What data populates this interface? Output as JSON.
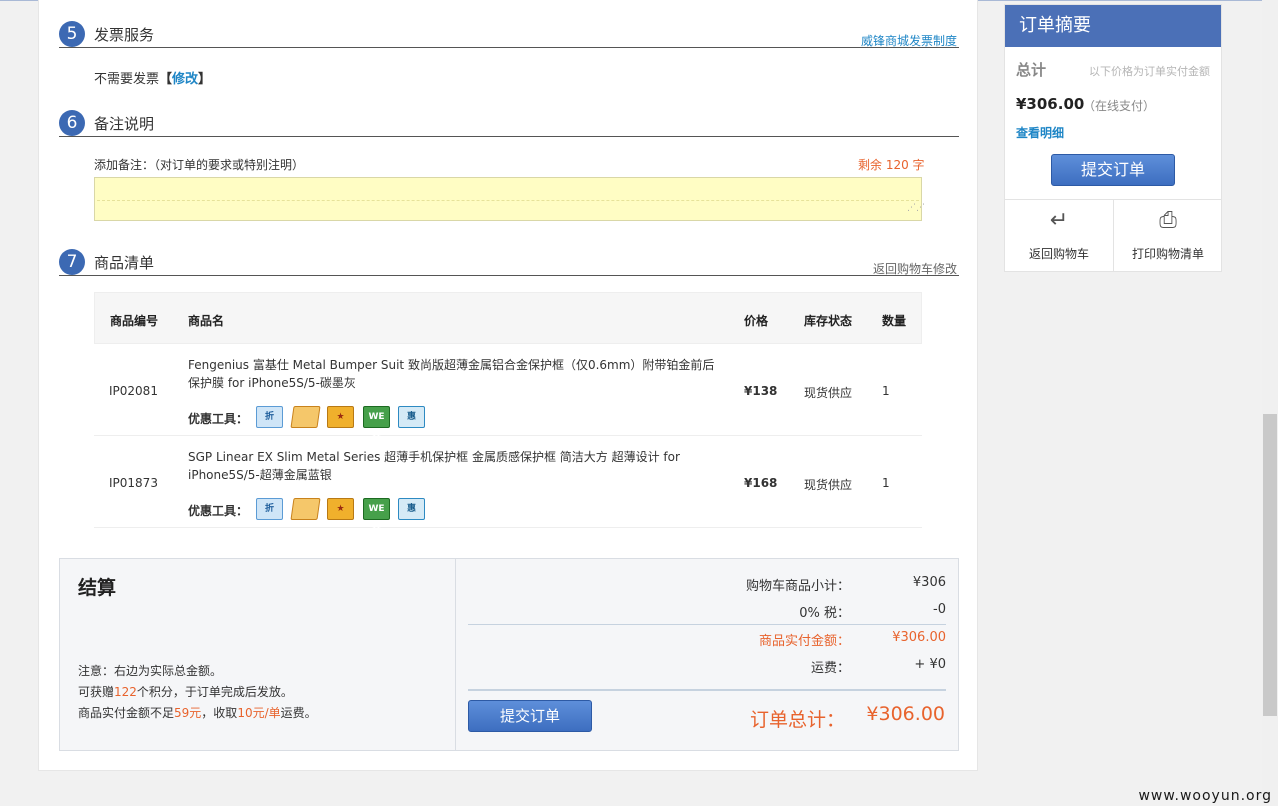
{
  "sections": {
    "invoice": {
      "num": "5",
      "title": "发票服务",
      "link": "威锋商城发票制度",
      "text": "不需要发票",
      "bracket_open": "【",
      "modify": "修改",
      "bracket_close": "】"
    },
    "remark": {
      "num": "6",
      "title": "备注说明",
      "label": "添加备注：（对订单的要求或特别注明）",
      "remaining": "剩余 120 字",
      "placeholder": ""
    },
    "goods": {
      "num": "7",
      "title": "商品清单",
      "link": "返回购物车修改"
    }
  },
  "table": {
    "headers": {
      "code": "商品编号",
      "name": "商品名",
      "price": "价格",
      "stock": "库存状态",
      "qty": "数量"
    },
    "rows": [
      {
        "code": "IP02081",
        "name": "Fengenius 富基仕 Metal Bumper Suit 致尚版超薄金属铝合金保护框（仅0.6mm）附带铂金前后保护膜 for iPhone5S/5-碳墨灰",
        "tools_label": "优惠工具：",
        "price": "¥138",
        "stock": "现货供应",
        "qty": "1"
      },
      {
        "code": "IP01873",
        "name": "SGP Linear EX Slim Metal Series 超薄手机保护框 金属质感保护框 简洁大方 超薄设计 for iPhone5S/5-超薄金属蓝银",
        "tools_label": "优惠工具：",
        "price": "¥168",
        "stock": "现货供应",
        "qty": "1"
      }
    ],
    "tool_icons": [
      {
        "icon": "member-discount-icon",
        "glyph": "折"
      },
      {
        "icon": "coupon-ticket-icon",
        "glyph": ""
      },
      {
        "icon": "star-voucher-icon",
        "glyph": "★"
      },
      {
        "icon": "we-coin-icon",
        "glyph": "WE券"
      },
      {
        "icon": "benefit-icon",
        "glyph": "惠"
      }
    ]
  },
  "settlement": {
    "title": "结算",
    "notes": {
      "line1": "注意：右边为实际总金额。",
      "line2_a": "可获赠",
      "line2_points": "122",
      "line2_b": "个积分，于订单完成后发放。",
      "line3_a": "商品实付金额不足",
      "line3_min": "59元",
      "line3_b": "，收取",
      "line3_fee": "10元/单",
      "line3_c": "运费。"
    },
    "subtotal_label": "购物车商品小计：",
    "subtotal": "¥306",
    "tax_label": "0% 税：",
    "tax": "-0",
    "paid_label": "商品实付金额：",
    "paid": "¥306.00",
    "shipping_label": "运费：",
    "shipping": "+ ¥0",
    "submit": "提交订单",
    "total_label": "订单总计：",
    "total": "¥306.00"
  },
  "sidebar": {
    "title": "订单摘要",
    "total_label": "总计",
    "total_note": "以下价格为订单实付金额",
    "price": "¥306.00",
    "pay_method": "（在线支付）",
    "detail_link": "查看明细",
    "submit": "提交订单",
    "back_cart": "返回购物车",
    "print_list": "打印购物清单"
  },
  "watermark": "www.wooyun.org",
  "colors": {
    "accent": "#3c69b3",
    "orange": "#e8632d",
    "link": "#1f86c6"
  }
}
